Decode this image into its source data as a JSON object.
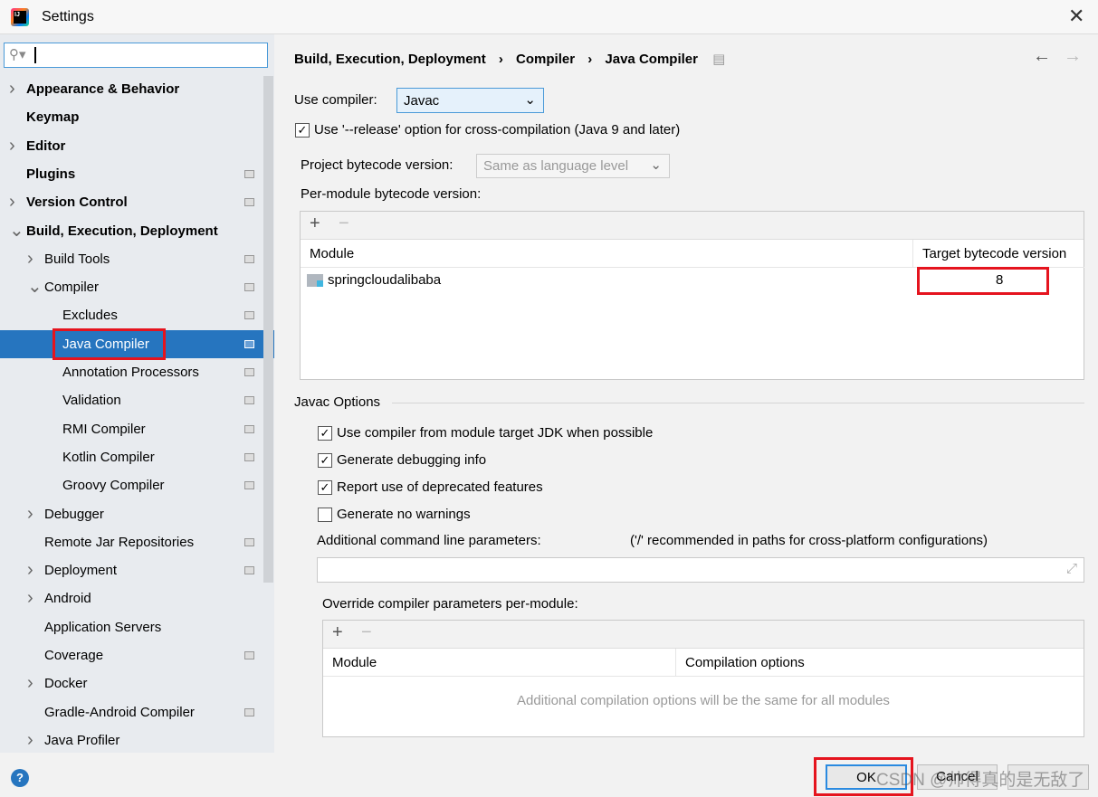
{
  "window": {
    "title": "Settings"
  },
  "search": {
    "placeholder": ""
  },
  "sidebar": {
    "items": [
      {
        "label": "Appearance & Behavior",
        "level": 0,
        "bold": true,
        "arrow": "right",
        "icon": false
      },
      {
        "label": "Keymap",
        "level": 0,
        "bold": true,
        "arrow": "",
        "icon": false
      },
      {
        "label": "Editor",
        "level": 0,
        "bold": true,
        "arrow": "right",
        "icon": false
      },
      {
        "label": "Plugins",
        "level": 0,
        "bold": true,
        "arrow": "",
        "icon": true
      },
      {
        "label": "Version Control",
        "level": 0,
        "bold": true,
        "arrow": "right",
        "icon": true
      },
      {
        "label": "Build, Execution, Deployment",
        "level": 0,
        "bold": true,
        "arrow": "down",
        "icon": false
      },
      {
        "label": "Build Tools",
        "level": 1,
        "bold": false,
        "arrow": "right",
        "icon": true
      },
      {
        "label": "Compiler",
        "level": 1,
        "bold": false,
        "arrow": "down",
        "icon": true
      },
      {
        "label": "Excludes",
        "level": 2,
        "bold": false,
        "arrow": "",
        "icon": true
      },
      {
        "label": "Java Compiler",
        "level": 2,
        "bold": false,
        "arrow": "",
        "icon": true,
        "selected": true
      },
      {
        "label": "Annotation Processors",
        "level": 2,
        "bold": false,
        "arrow": "",
        "icon": true
      },
      {
        "label": "Validation",
        "level": 2,
        "bold": false,
        "arrow": "",
        "icon": true
      },
      {
        "label": "RMI Compiler",
        "level": 2,
        "bold": false,
        "arrow": "",
        "icon": true
      },
      {
        "label": "Kotlin Compiler",
        "level": 2,
        "bold": false,
        "arrow": "",
        "icon": true
      },
      {
        "label": "Groovy Compiler",
        "level": 2,
        "bold": false,
        "arrow": "",
        "icon": true
      },
      {
        "label": "Debugger",
        "level": 1,
        "bold": false,
        "arrow": "right",
        "icon": false
      },
      {
        "label": "Remote Jar Repositories",
        "level": 1,
        "bold": false,
        "arrow": "",
        "icon": true
      },
      {
        "label": "Deployment",
        "level": 1,
        "bold": false,
        "arrow": "right",
        "icon": true
      },
      {
        "label": "Android",
        "level": 1,
        "bold": false,
        "arrow": "right",
        "icon": false
      },
      {
        "label": "Application Servers",
        "level": 1,
        "bold": false,
        "arrow": "",
        "icon": false
      },
      {
        "label": "Coverage",
        "level": 1,
        "bold": false,
        "arrow": "",
        "icon": true
      },
      {
        "label": "Docker",
        "level": 1,
        "bold": false,
        "arrow": "right",
        "icon": false
      },
      {
        "label": "Gradle-Android Compiler",
        "level": 1,
        "bold": false,
        "arrow": "",
        "icon": true
      },
      {
        "label": "Java Profiler",
        "level": 1,
        "bold": false,
        "arrow": "right",
        "icon": false
      }
    ]
  },
  "breadcrumb": [
    "Build, Execution, Deployment",
    "Compiler",
    "Java Compiler"
  ],
  "compiler": {
    "label": "Use compiler:",
    "value": "Javac"
  },
  "release": {
    "label": "Use '--release' option for cross-compilation (Java 9 and later)",
    "checked": true
  },
  "bytecode": {
    "label": "Project bytecode version:",
    "value": "Same as language level"
  },
  "per_module": {
    "label": "Per-module bytecode version:",
    "col_module": "Module",
    "col_target": "Target bytecode version",
    "rows": [
      {
        "module": "springcloudalibaba",
        "target": "8"
      }
    ]
  },
  "javac": {
    "title": "Javac Options",
    "options": [
      {
        "label": "Use compiler from module target JDK when possible",
        "checked": true
      },
      {
        "label": "Generate debugging info",
        "checked": true
      },
      {
        "label": "Report use of deprecated features",
        "checked": true
      },
      {
        "label": "Generate no warnings",
        "checked": false
      }
    ],
    "params_label": "Additional command line parameters:",
    "params_hint": "('/' recommended in paths for cross-platform configurations)",
    "params_value": ""
  },
  "override": {
    "label": "Override compiler parameters per-module:",
    "col_module": "Module",
    "col_options": "Compilation options",
    "empty": "Additional compilation options will be the same for all modules"
  },
  "buttons": {
    "ok": "OK",
    "cancel": "Cancel",
    "apply": ""
  },
  "watermark": "CSDN @帅得真的是无敌了",
  "colors": {
    "selection": "#2675bf",
    "highlight": "#e5141e",
    "focus": "#4a9ad8"
  }
}
